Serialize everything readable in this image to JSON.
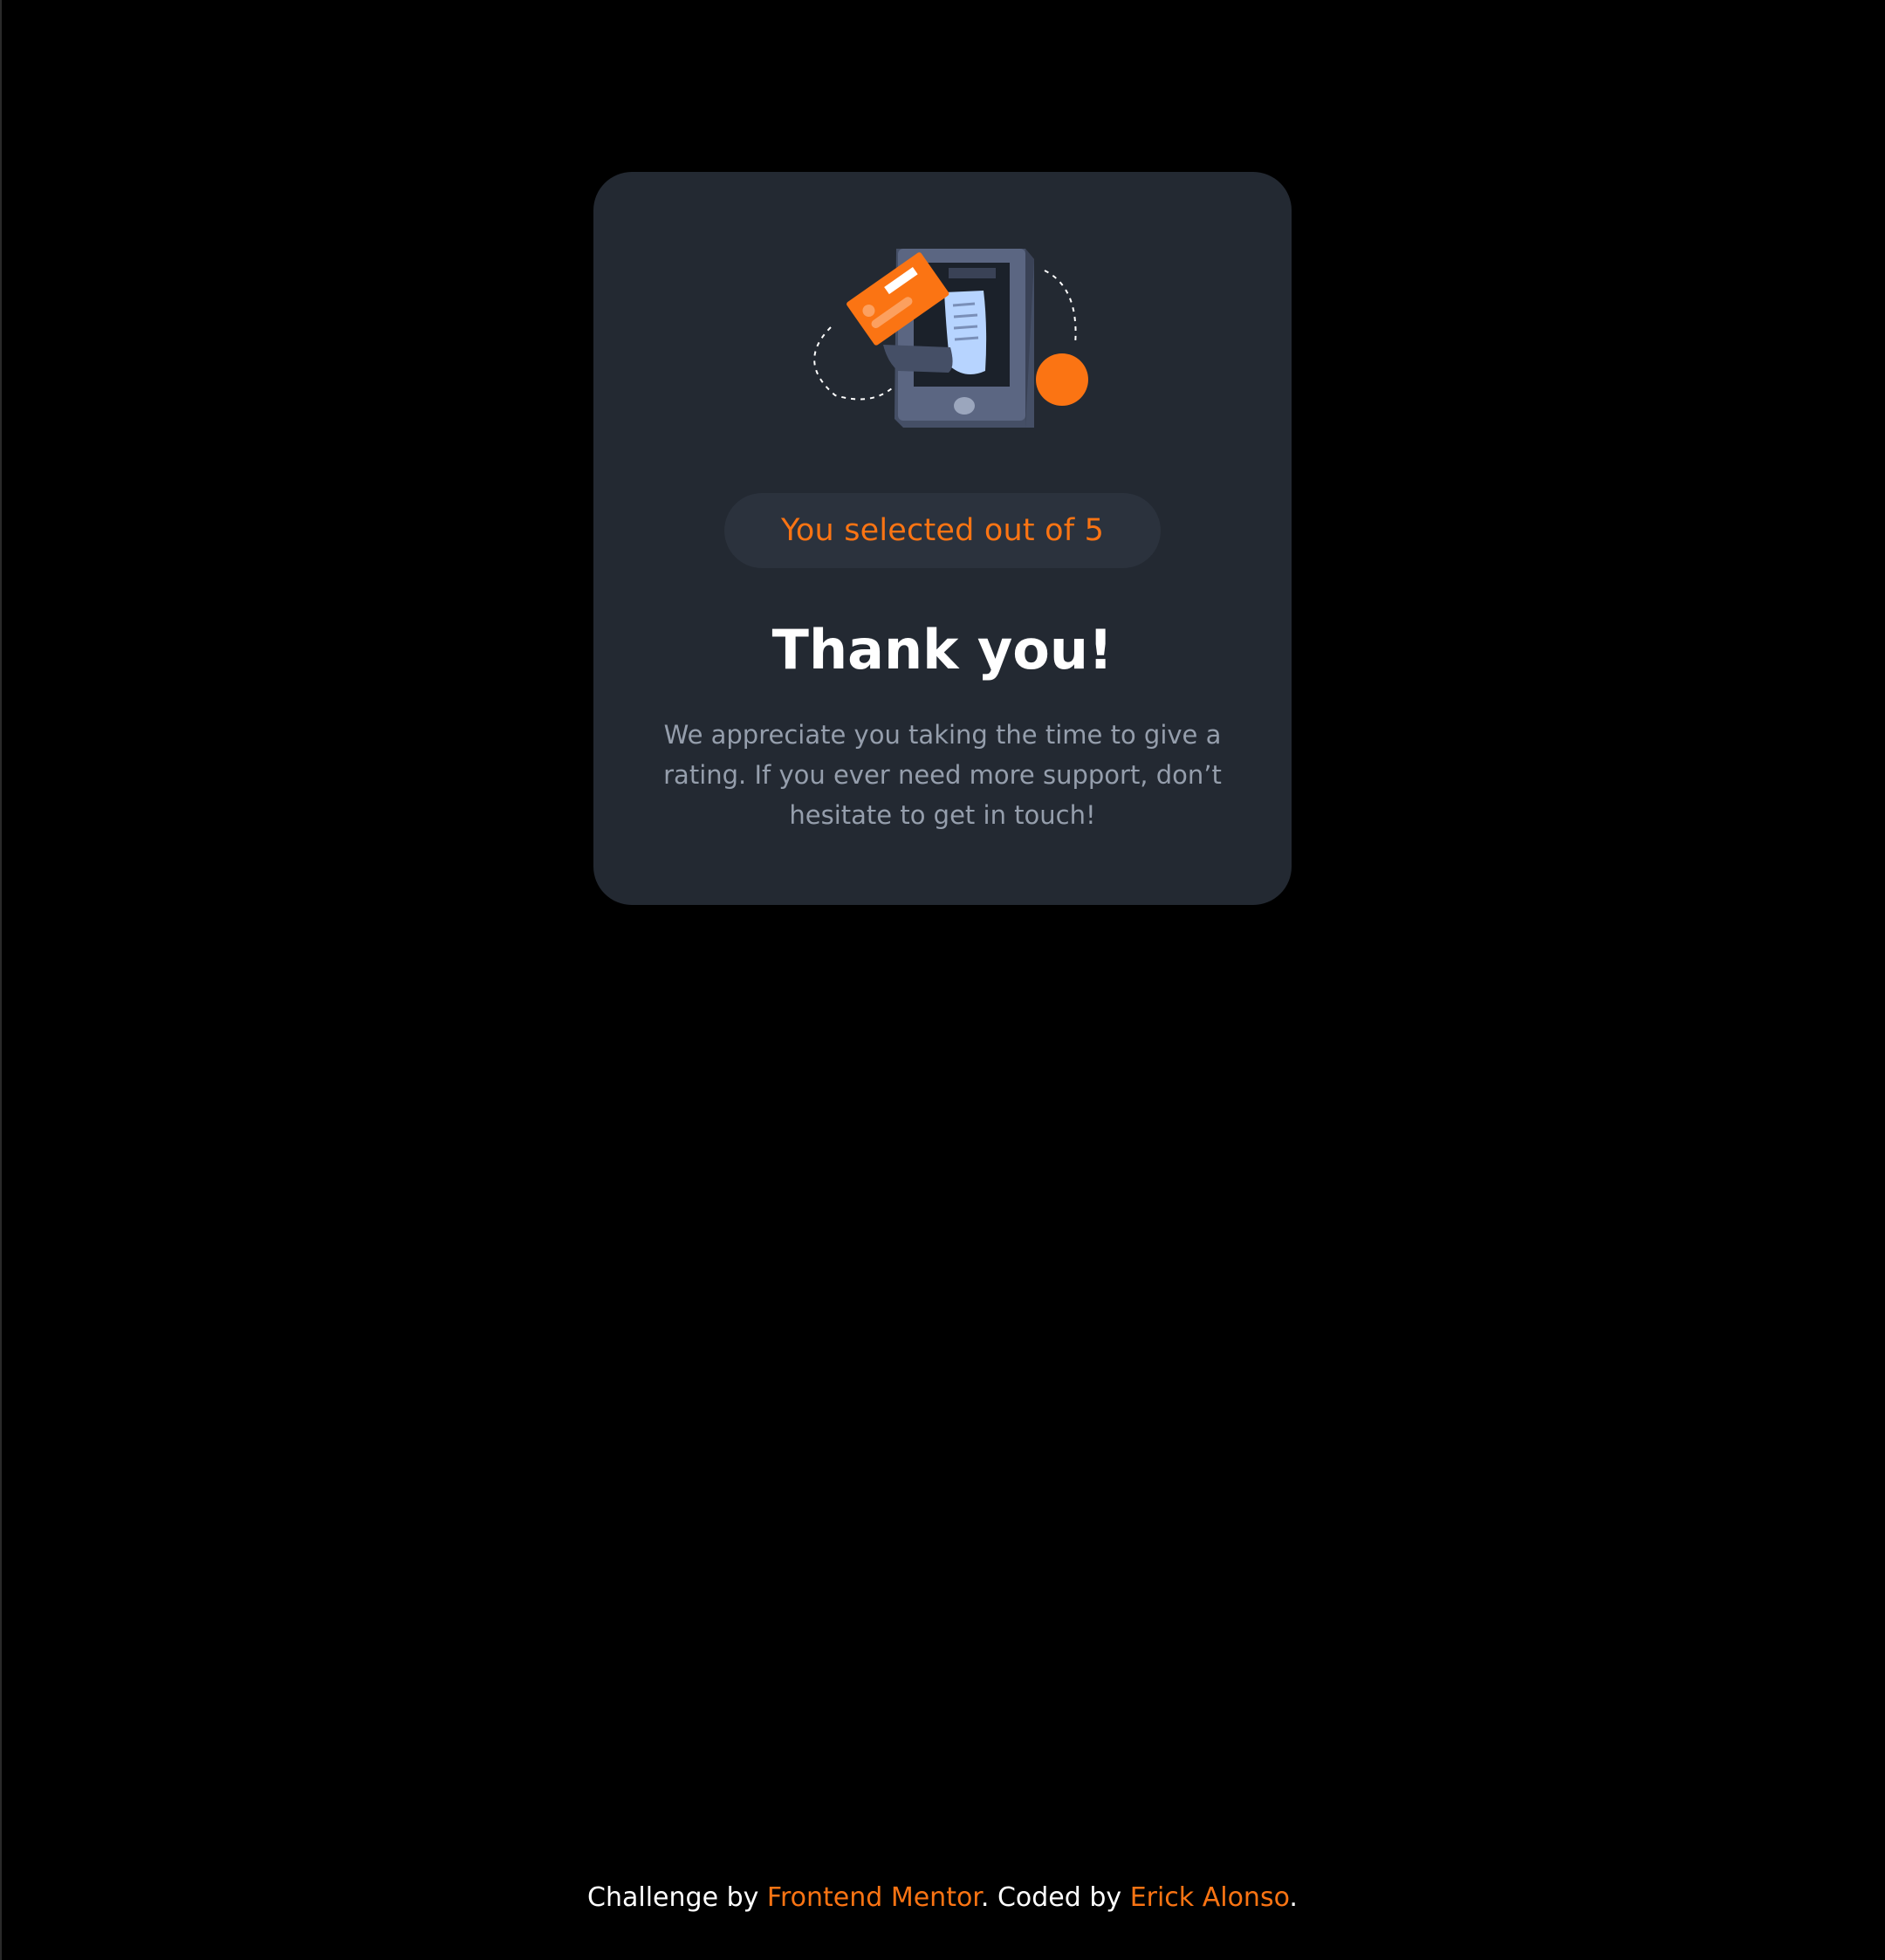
{
  "card": {
    "illustration_icon": "phone-payment-receipt-illustration",
    "badge_text": "You selected out of 5",
    "title": "Thank you!",
    "message": "We appreciate you taking the time to give a rating. If you ever need more support, don’t hesitate to get in touch!"
  },
  "footer": {
    "prefix": "Challenge by ",
    "challenge_link": "Frontend Mentor",
    "middle": ". Coded by ",
    "author_link": "Erick Alonso",
    "suffix": "."
  },
  "colors": {
    "background": "#000000",
    "card": "#232932",
    "accent": "#fb7413",
    "text_muted": "#959eac",
    "text_primary": "#ffffff"
  }
}
